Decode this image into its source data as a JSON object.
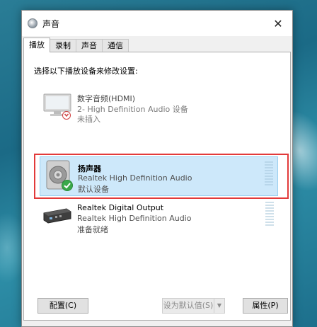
{
  "window": {
    "title": "声音",
    "close_glyph": "✕"
  },
  "tabs": [
    {
      "label": "播放",
      "active": true
    },
    {
      "label": "录制",
      "active": false
    },
    {
      "label": "声音",
      "active": false
    },
    {
      "label": "通信",
      "active": false
    }
  ],
  "panel": {
    "instructions": "选择以下播放设备来修改设置:"
  },
  "devices": [
    {
      "name": "数字音频(HDMI)",
      "description": "2- High Definition Audio 设备",
      "status": "未插入",
      "icon": "monitor-icon",
      "state": "unplugged"
    },
    {
      "name": "扬声器",
      "description": "Realtek High Definition Audio",
      "status": "默认设备",
      "icon": "speaker-icon",
      "state": "default"
    },
    {
      "name": "Realtek Digital Output",
      "description": "Realtek High Definition Audio",
      "status": "准备就绪",
      "icon": "digital-output-icon",
      "state": "ready"
    }
  ],
  "buttons": {
    "configure": "配置(C)",
    "set_default": "设为默认值(S)",
    "properties": "属性(P)"
  },
  "colors": {
    "highlight_box": "#e23a3a",
    "selection": "#cde8fa",
    "default_check": "#3aa84a"
  }
}
